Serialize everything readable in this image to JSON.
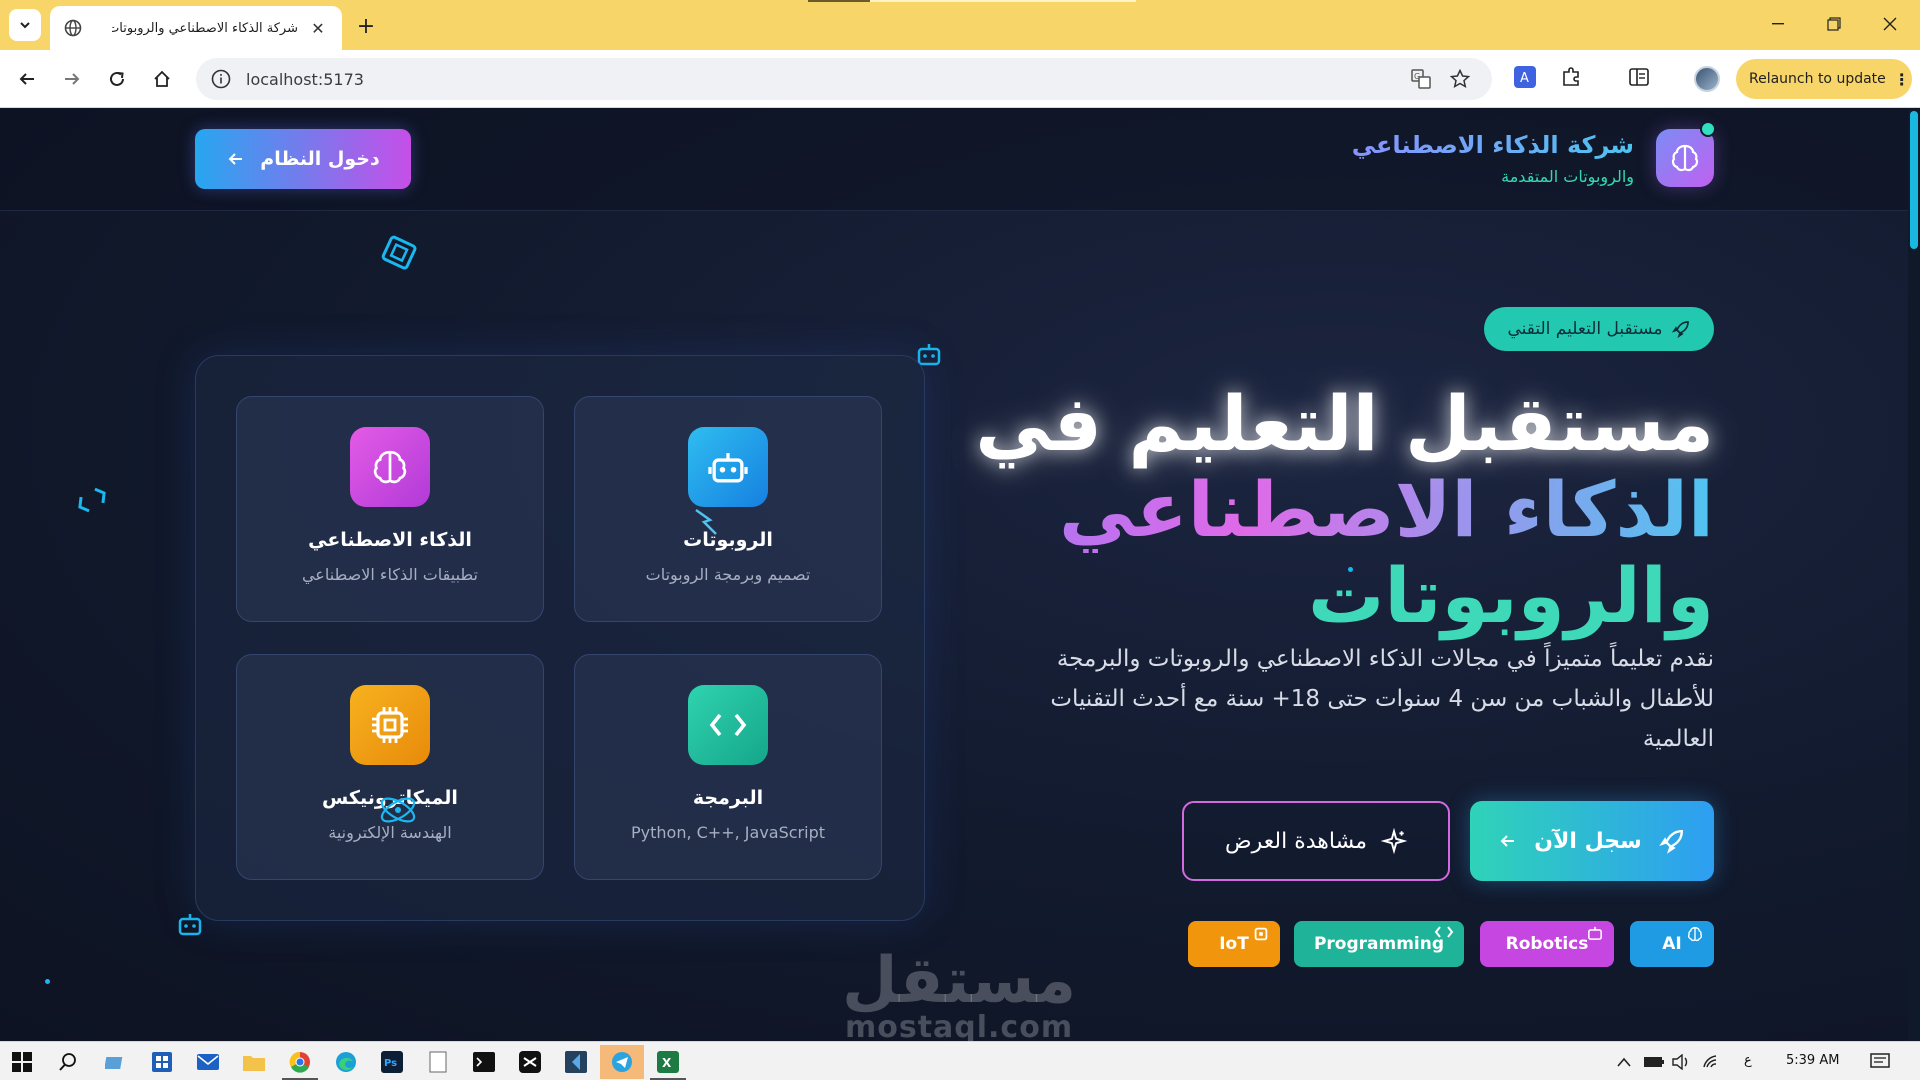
{
  "browser": {
    "tab_title": "شركة الذكاء الاصطناعي والروبوتات",
    "new_tab_symbol": "+",
    "close_symbol": "✕",
    "url": "localhost:5173",
    "relaunch_label": "Relaunch to update",
    "relaunch_menu": "⋮",
    "icons": [
      "tab-search-icon",
      "globe-icon",
      "close-icon",
      "back-arrow-icon",
      "forward-arrow-icon",
      "reload-icon",
      "home-icon",
      "site-info-icon",
      "translate-icon",
      "star-icon",
      "extension-puzzle-icon",
      "reading-list-icon",
      "profile-avatar"
    ]
  },
  "header": {
    "brand_name": "شركة الذكاء الاصطناعي",
    "brand_sub": "والروبوتات المتقدمة",
    "login_label": "دخول النظام"
  },
  "hero": {
    "badge": "مستقبل التعليم التقني",
    "title_line1": "مستقبل التعليم في",
    "title_line2": "الذكاء الاصطناعي",
    "title_line3": "والروبوتات",
    "description": "نقدم تعليماً متميزاً في مجالات الذكاء الاصطناعي والروبوتات والبرمجة للأطفال والشباب من سن 4 سنوات حتى 18+ سنة مع أحدث التقنيات العالمية",
    "cta_primary": "سجل الآن",
    "cta_secondary": "مشاهدة العرض",
    "tags": [
      {
        "label": "AI",
        "color": "#1e9be3"
      },
      {
        "label": "Robotics",
        "color": "#c546e0"
      },
      {
        "label": "Programming",
        "color": "#1fb49a"
      },
      {
        "label": "IoT",
        "color": "#f0950c"
      }
    ]
  },
  "cards": [
    {
      "title": "الروبوتات",
      "subtitle": "تصميم وبرمجة الروبوتات",
      "icon": "robot-icon",
      "color": "#1ea7e8"
    },
    {
      "title": "الذكاء الاصطناعي",
      "subtitle": "تطبيقات الذكاء الاصطناعي",
      "icon": "brain-icon",
      "color": "#d346df"
    },
    {
      "title": "البرمجة",
      "subtitle": "Python, C++, JavaScript",
      "icon": "code-icon",
      "color": "#1fbf9d"
    },
    {
      "title": "الميكاترونيكس",
      "subtitle": "الهندسة الإلكترونية",
      "icon": "chip-icon",
      "color": "#f0a012"
    }
  ],
  "watermark": {
    "arabic": "مستقل",
    "latin": "mostaql.com"
  },
  "taskbar": {
    "time": "5:39 AM",
    "lang": "ع",
    "apps": [
      "windows-start-icon",
      "search-icon",
      "file-explorer-icon",
      "store-icon",
      "mail-icon",
      "folder-icon",
      "chrome-icon",
      "edge-icon",
      "photoshop-icon",
      "notepad-icon",
      "terminal-icon",
      "capcut-icon",
      "vscode-icon",
      "telegram-icon",
      "excel-icon"
    ]
  },
  "colors": {
    "accent_teal": "#2fd3b8",
    "accent_blue": "#2e9ef2",
    "accent_pink": "#d36ae0",
    "chrome_yellow": "#f8d568"
  }
}
